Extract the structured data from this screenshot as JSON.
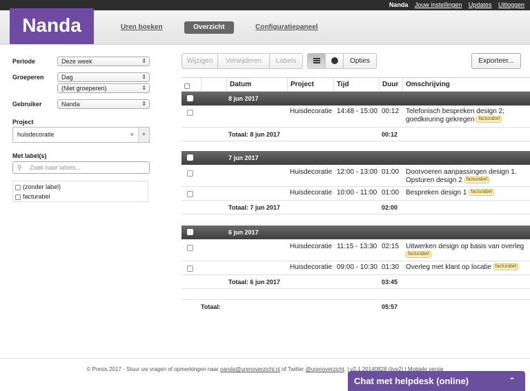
{
  "topbar": {
    "user": "Nanda",
    "settings": "Jouw instellingen",
    "updates": "Updates",
    "logout": "Uitloggen"
  },
  "logo": "Nanda",
  "nav": {
    "book": "Uren boeken",
    "overview": "Overzicht",
    "config": "Configuratiepaneel"
  },
  "filters": {
    "period_label": "Periode",
    "period_value": "Deze week",
    "group_label": "Groeperen",
    "group_value": "Dag",
    "group_value2": "(Niet groeperen)",
    "user_label": "Gebruiker",
    "user_value": "Nanda",
    "project_label": "Project",
    "project_value": "huisdecoratie",
    "labels_label": "Met label(s)",
    "labels_placeholder": "Zoek naar labels...",
    "label_opts": [
      "(zonder label)",
      "facturabel"
    ]
  },
  "toolbar": {
    "edit": "Wijzigen",
    "delete": "Verwijderen",
    "labels": "Labels",
    "options": "Opties",
    "export": "Exporteer..."
  },
  "columns": {
    "date": "Datum",
    "project": "Project",
    "time": "Tijd",
    "duration": "Duur",
    "desc": "Omschrijving"
  },
  "groups": [
    {
      "date": "8 jun 2017",
      "total_label": "Totaal: 8 jun 2017",
      "total": "00:12",
      "rows": [
        {
          "project": "Huisdecoratie",
          "time": "14:48 - 15:00",
          "dur": "00:12",
          "desc1": "Telefonisch bespreken design 2;",
          "desc2": "goedkeuring gekregen",
          "tag": "facturabel"
        }
      ]
    },
    {
      "date": "7 jun 2017",
      "total_label": "Totaal: 7 jun 2017",
      "total": "02:00",
      "rows": [
        {
          "project": "Huisdecoratie",
          "time": "12:00 - 13:00",
          "dur": "01:00",
          "desc1": "Doorvoeren aanpassingen design 1.",
          "desc2": "Opsturen design 2",
          "tag": "facturabel"
        },
        {
          "project": "Huisdecoratie",
          "time": "10:00 - 11:00",
          "dur": "01:00",
          "desc1": "Bespreken design 1",
          "tag": "facturabel"
        }
      ]
    },
    {
      "date": "6 jun 2017",
      "total_label": "Totaal: 6 jun 2017",
      "total": "03:45",
      "rows": [
        {
          "project": "Huisdecoratie",
          "time": "11:15 - 13:30",
          "dur": "02:15",
          "desc1": "Uitwerken design op basis van overleg",
          "tag": "facturabel"
        },
        {
          "project": "Huisdecoratie",
          "time": "09:00 - 10:30",
          "dur": "01:30",
          "desc1": "Overleg met klant op locatie",
          "tag": "facturabel"
        }
      ]
    }
  ],
  "grand_total_label": "Totaal:",
  "grand_total": "05:57",
  "footer": {
    "pre": "© Presis 2017 - Stuur uw vragen of opmerkingen naar",
    "email": "nanda@urenoverzicht.nl",
    "mid": "of Twitter",
    "twitter": "@urenoverzicht",
    "post": ". | v2.1.20140828 (live2) | Mobiele versie"
  },
  "chat": {
    "label": "Chat met helpdesk (online)",
    "icon": "chevron-up-icon"
  },
  "colors": {
    "brand": "#6e4aa5",
    "chat": "#6b4f9f",
    "group_bar": "#4a4a4a",
    "tag_bg": "#fbefbb"
  }
}
